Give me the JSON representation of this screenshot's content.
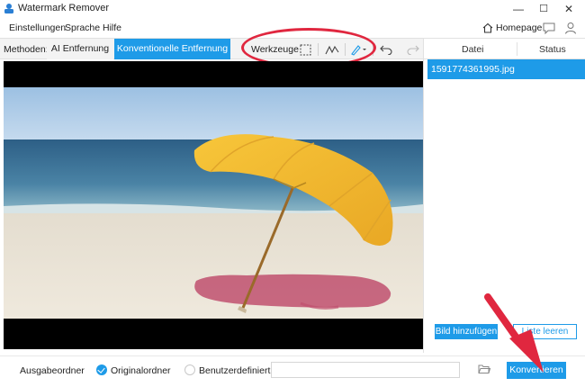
{
  "window": {
    "title": "Watermark Remover",
    "minimize_glyph": "—",
    "maximize_glyph": "☐",
    "close_glyph": "✕"
  },
  "menu": {
    "items": [
      "Einstellungen",
      "Sprache",
      "Hilfe"
    ],
    "homepage_label": "Homepage"
  },
  "toolbar": {
    "methods_label": "Methoden:",
    "tabs": [
      {
        "label": "AI Entfernung",
        "active": false
      },
      {
        "label": "Konventionelle Entfernung",
        "active": true
      }
    ],
    "tools_label": "Werkzeuge",
    "tools": [
      "rect-select-icon",
      "lasso-icon",
      "brush-icon",
      "undo-icon",
      "redo-icon"
    ]
  },
  "file_panel": {
    "columns": [
      "Datei",
      "Status"
    ],
    "files": [
      {
        "name": "1591774361995.jpg",
        "status": "",
        "selected": true
      }
    ],
    "add_button": "Bild hinzufügen",
    "clear_button": "Liste leeren"
  },
  "output": {
    "label": "Ausgabeordner",
    "options": [
      {
        "label": "Originalordner",
        "checked": true
      },
      {
        "label": "Benutzerdefiniert",
        "checked": false
      }
    ],
    "path_value": "",
    "convert_button": "Konvertieren"
  },
  "colors": {
    "accent": "#1e9be8",
    "annotation": "#e0273f",
    "selection_mask": "#c0506e"
  }
}
